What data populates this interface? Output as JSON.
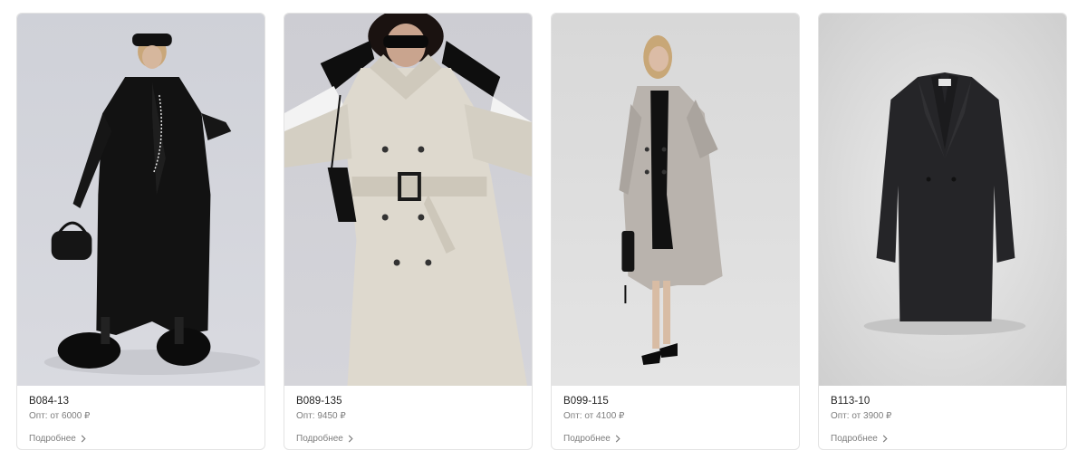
{
  "products": [
    {
      "sku": "B084-13",
      "price": "Опт: от 6000 ₽",
      "more_label": "Подробнее",
      "photo_desc": "model-black-long-trench"
    },
    {
      "sku": "B089-135",
      "price": "Опт: 9450 ₽",
      "more_label": "Подробнее",
      "photo_desc": "model-beige-belted-trench"
    },
    {
      "sku": "B099-115",
      "price": "Опт: от 4100 ₽",
      "more_label": "Подробнее",
      "photo_desc": "model-grey-trench"
    },
    {
      "sku": "B113-10",
      "price": "Опт: от 3900 ₽",
      "more_label": "Подробнее",
      "photo_desc": "black-blazer-dress"
    }
  ],
  "colors": {
    "card_border": "#e3e3e3",
    "sku_text": "#222222",
    "muted_text": "#7d7d7d"
  }
}
